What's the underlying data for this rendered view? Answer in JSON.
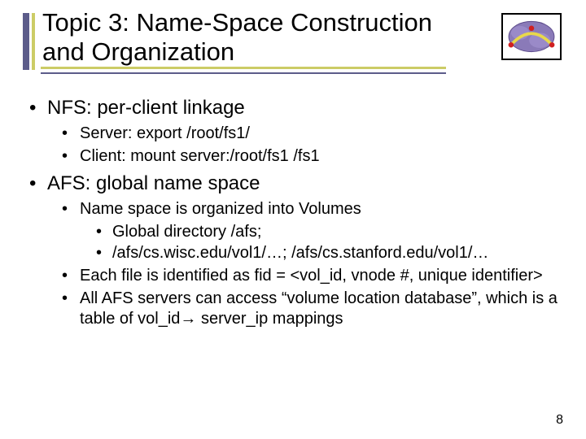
{
  "title": "Topic 3: Name-Space Construction and Organization",
  "bullets": {
    "b1": "NFS: per-client linkage",
    "b1_1": "Server: export /root/fs1/",
    "b1_2": "Client: mount server:/root/fs1 /fs1",
    "b2": "AFS: global name space",
    "b2_1": "Name space is organized into Volumes",
    "b2_1_1": "Global directory /afs;",
    "b2_1_2": "/afs/cs.wisc.edu/vol1/…; /afs/cs.stanford.edu/vol1/…",
    "b2_2": "Each file is identified as fid = <vol_id, vnode #, unique identifier>",
    "b2_3": "All AFS servers can access “volume location database”, which is a table of vol_id→ server_ip mappings"
  },
  "page": "8"
}
